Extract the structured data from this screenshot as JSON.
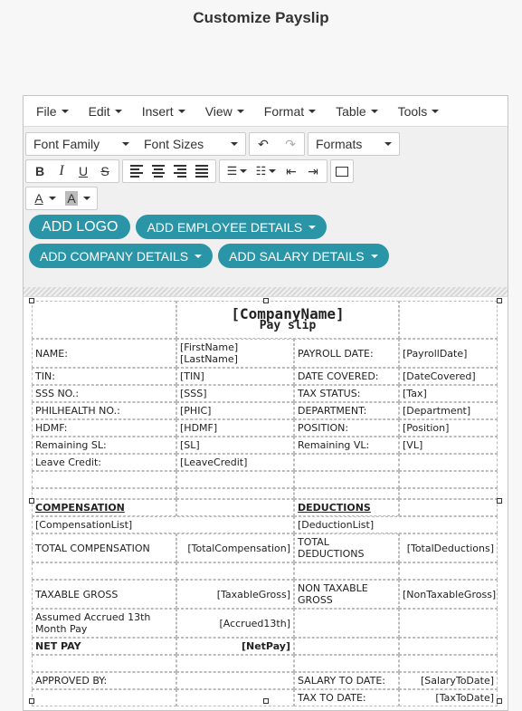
{
  "page": {
    "title": "Customize Payslip"
  },
  "menu": [
    "File",
    "Edit",
    "Insert",
    "View",
    "Format",
    "Table",
    "Tools"
  ],
  "toolbar": {
    "font_family": "Font Family",
    "font_sizes": "Font Sizes",
    "formats": "Formats",
    "undo_icon": "undo-icon",
    "redo_icon": "redo-icon"
  },
  "actions": {
    "add_logo": "ADD LOGO",
    "add_employee": "ADD EMPLOYEE DETAILS",
    "add_company": "ADD COMPANY DETAILS",
    "add_salary": "ADD SALARY DETAILS"
  },
  "payslip": {
    "company": "[CompanyName]",
    "subtitle": "Pay slip",
    "rows": [
      [
        "NAME:",
        "[FirstName] [LastName]",
        "PAYROLL DATE:",
        "[PayrollDate]"
      ],
      [
        "TIN:",
        "[TIN]",
        "DATE COVERED:",
        "[DateCovered]"
      ],
      [
        "SSS NO.:",
        "[SSS]",
        "TAX STATUS:",
        "[Tax]"
      ],
      [
        "PHILHEALTH NO.:",
        "[PHIC]",
        "DEPARTMENT:",
        "[Department]"
      ],
      [
        "HDMF:",
        "[HDMF]",
        "POSITION:",
        "[Position]"
      ],
      [
        "Remaining SL:",
        "[SL]",
        "Remaining VL:",
        "[VL]"
      ],
      [
        "Leave Credit:",
        "[LeaveCredit]",
        "",
        ""
      ]
    ],
    "compensation_label": "COMPENSATION",
    "deductions_label": "DEDUCTIONS",
    "compensation_list": "[CompensationList]",
    "deduction_list": "[DeductionList]",
    "total_comp_label": "TOTAL COMPENSATION",
    "total_comp": "[TotalCompensation]",
    "total_ded_label": "TOTAL DEDUCTIONS",
    "total_ded": "[TotalDeductions]",
    "taxable_label": "TAXABLE GROSS",
    "taxable": "[TaxableGross]",
    "nontaxable_label": "NON TAXABLE GROSS",
    "nontaxable": "[NonTaxableGross]",
    "accrued_label": "Assumed Accrued 13th Month Pay",
    "accrued": "[Accrued13th]",
    "netpay_label": "NET PAY",
    "netpay": "[NetPay]",
    "approved_label": "APPROVED BY:",
    "salary_to_date_label": "SALARY TO DATE:",
    "salary_to_date": "[SalaryToDate]",
    "tax_to_date_label": "TAX TO DATE:",
    "tax_to_date": "[TaxToDate]"
  }
}
